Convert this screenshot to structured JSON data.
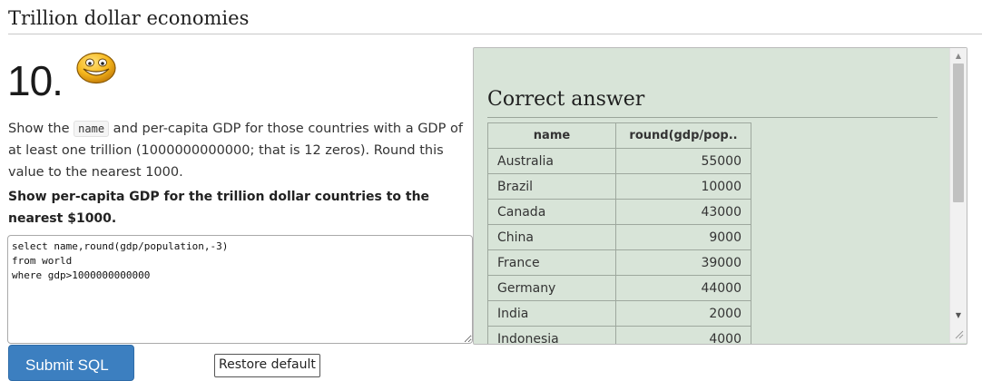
{
  "page": {
    "title": "Trillion dollar economies"
  },
  "question": {
    "number": "10.",
    "description_parts": [
      "Show the ",
      "name",
      " and per-capita GDP for those countries with a GDP of at least one trillion (1000000000000; that is 12 zeros). Round this value to the nearest 1000."
    ],
    "task": "Show per-capita GDP for the trillion dollar countries to the nearest $1000."
  },
  "editor": {
    "sql": "select name,round(gdp/population,-3)\nfrom world\nwhere gdp>1000000000000"
  },
  "buttons": {
    "submit": "Submit SQL",
    "restore": "Restore default"
  },
  "answer": {
    "title": "Correct answer",
    "columns": [
      "name",
      "round(gdp/pop.."
    ],
    "rows": [
      [
        "Australia",
        "55000"
      ],
      [
        "Brazil",
        "10000"
      ],
      [
        "Canada",
        "43000"
      ],
      [
        "China",
        "9000"
      ],
      [
        "France",
        "39000"
      ],
      [
        "Germany",
        "44000"
      ],
      [
        "India",
        "2000"
      ],
      [
        "Indonesia",
        "4000"
      ]
    ]
  },
  "icons": {
    "smiley": "smiley-face-icon",
    "scroll_up": "scroll-up-arrow-icon",
    "scroll_down": "scroll-down-arrow-icon",
    "resize": "resize-grip-icon"
  },
  "colors": {
    "answer_bg": "#d8e4d8",
    "submit_bg": "#3c7fc0",
    "smiley_face": "#f4b41a"
  }
}
